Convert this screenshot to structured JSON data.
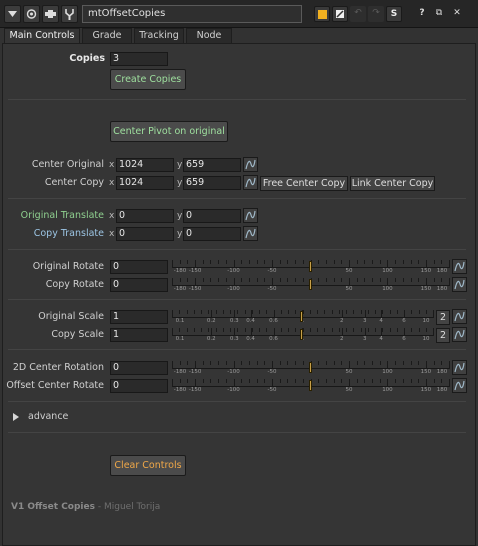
{
  "window": {
    "node_name": "mtOffsetCopies",
    "toolbar_icons": [
      "collapse-arrow-icon",
      "viewer-icon",
      "centre-icon",
      "settings-icon"
    ],
    "right_icons": [
      "node-color-icon",
      "brush-icon",
      "undo-icon",
      "redo-icon",
      "s-icon",
      "help-icon",
      "float-icon",
      "close-icon"
    ],
    "right_glyphs": [
      "",
      "",
      "↶",
      "↷",
      "S",
      "?",
      "⧉",
      "✕"
    ]
  },
  "tabs": [
    "Main Controls",
    "Grade",
    "Tracking",
    "Node"
  ],
  "colors": {
    "label_green": "#8fd08f",
    "label_blue": "#9cc5e4",
    "accent_orange": "#f0a848",
    "knob": "#c8a048"
  },
  "copies": {
    "label": "Copies",
    "value": "3",
    "create_button": "Create Copies"
  },
  "center_pivot_button": "Center Pivot on original",
  "center_original": {
    "label": "Center Original",
    "x": "1024",
    "y": "659"
  },
  "center_copy": {
    "label": "Center Copy",
    "x": "1024",
    "y": "659",
    "free_button": "Free  Center Copy",
    "link_button": "Link Center Copy"
  },
  "original_translate": {
    "label": "Original Translate",
    "x": "0",
    "y": "0"
  },
  "copy_translate": {
    "label": "Copy Translate",
    "x": "0",
    "y": "0"
  },
  "axis": {
    "x": "x",
    "y": "y"
  },
  "rotate_ticks": [
    "-180",
    "-150",
    "-100",
    "-50",
    "0",
    "50",
    "100",
    "150",
    "180"
  ],
  "scale_ticks": [
    "0.1",
    "0.2",
    "0.3",
    "0.4",
    "0.6",
    "1",
    "2",
    "3",
    "4",
    "6",
    "10"
  ],
  "sliders": {
    "original_rotate": {
      "label": "Original Rotate",
      "value": "0",
      "level": 0
    },
    "copy_rotate": {
      "label": "Copy Rotate",
      "value": "0",
      "level": 0
    },
    "original_scale": {
      "label": "Original Scale",
      "value": "1",
      "level": 1,
      "channel_button": "2"
    },
    "copy_scale": {
      "label": "Copy Scale",
      "value": "1",
      "level": 1,
      "channel_button": "2"
    },
    "center_rotation_2d": {
      "label": "2D Center Rotation",
      "value": "0",
      "level": 0
    },
    "offset_center_rotate": {
      "label": "Offset Center Rotate",
      "value": "0",
      "level": 0
    }
  },
  "advance": {
    "label": "advance"
  },
  "clear_button": "Clear Controls",
  "footer": {
    "title": "V1 Offset Copies",
    "author": "- Miguel Torija"
  }
}
